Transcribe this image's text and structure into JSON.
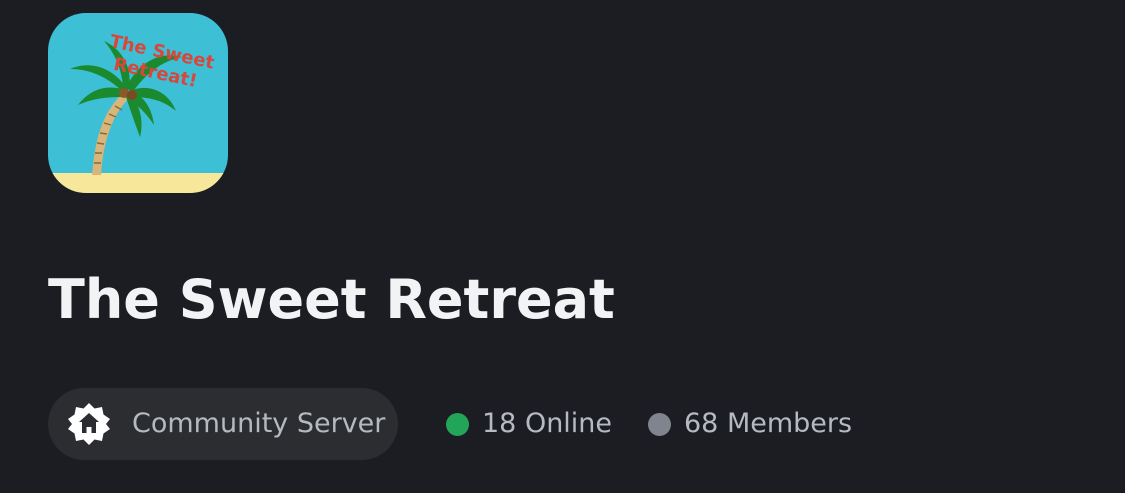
{
  "server": {
    "name": "The Sweet Retreat",
    "icon_name": "palm-tree-server-icon",
    "icon_text_line1": "The Sweet",
    "icon_text_line2": "Retreat!"
  },
  "badges": {
    "community_label": "Community Server",
    "community_icon": "community-server-icon"
  },
  "stats": {
    "online": "18 Online",
    "members": "68 Members"
  },
  "colors": {
    "background": "#1c1d22",
    "pill": "#2b2d31",
    "title": "#f2f3f5",
    "secondary_text": "#b5bac1",
    "online_dot": "#23a559",
    "members_dot": "#80848e",
    "icon_sky": "#3dbfd6",
    "icon_sand": "#f6e79a",
    "icon_text": "#d9463b"
  }
}
